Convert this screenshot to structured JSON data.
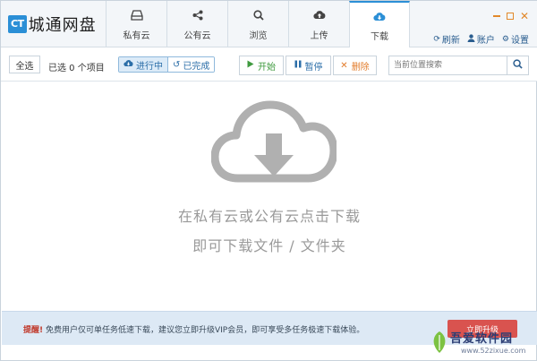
{
  "app": {
    "logo_badge": "CT",
    "logo_text": "城通网盘"
  },
  "tabs": [
    {
      "label": "私有云",
      "icon": "drive-icon",
      "active": false
    },
    {
      "label": "公有云",
      "icon": "share-icon",
      "active": false
    },
    {
      "label": "浏览",
      "icon": "search-icon",
      "active": false
    },
    {
      "label": "上传",
      "icon": "cloud-upload-icon",
      "active": false
    },
    {
      "label": "下载",
      "icon": "cloud-download-icon",
      "active": true
    }
  ],
  "window_controls": {
    "minimize": "minimize-icon",
    "maximize": "maximize-icon",
    "close": "close-icon"
  },
  "top_links": {
    "refresh": "刷新",
    "account": "账户",
    "settings": "设置"
  },
  "toolbar": {
    "select_all": "全选",
    "selected_count": "已选 0 个项目",
    "filter_in_progress": "进行中",
    "filter_completed": "已完成",
    "start": "开始",
    "pause": "暂停",
    "delete": "删除",
    "search_placeholder": "当前位置搜索"
  },
  "empty_state": {
    "line1": "在私有云或公有云点击下载",
    "line2": "即可下载文件 / 文件夹"
  },
  "notice": {
    "prefix": "提醒!",
    "text": "免费用户仅可单任务低速下载，建议您立即升级VIP会员，即可享受多任务极速下载体验。",
    "button": "立即升级"
  },
  "watermark": {
    "name": "吾爱软件园",
    "url": "www.52zixue.com"
  },
  "colors": {
    "accent": "#2b8fd6",
    "start": "#3f9a3f",
    "pause": "#2b6ea8",
    "delete": "#e27c2b",
    "cloud": "#b0b0b0",
    "notice_bg": "#dde9f5"
  }
}
